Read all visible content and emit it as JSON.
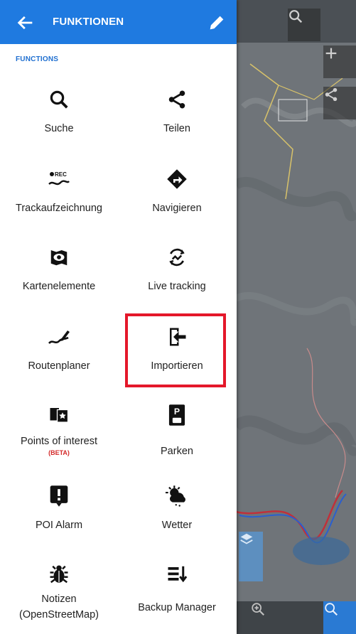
{
  "app_bar": {
    "title": "FUNKTIONEN",
    "back_icon": "arrow-left-icon",
    "edit_icon": "pencil-icon"
  },
  "section_title": "FUNCTIONS",
  "colors": {
    "app_bar": "#1f7ae0",
    "highlight_border": "#e4172a",
    "beta_badge": "#d42a2a"
  },
  "functions": [
    {
      "label": "Suche",
      "icon": "search-icon"
    },
    {
      "label": "Teilen",
      "icon": "share-icon"
    },
    {
      "label": "Trackaufzeichnung",
      "icon": "track-record-icon"
    },
    {
      "label": "Navigieren",
      "icon": "navigation-icon"
    },
    {
      "label": "Kartenelemente",
      "icon": "map-elements-icon"
    },
    {
      "label": "Live tracking",
      "icon": "live-tracking-icon"
    },
    {
      "label": "Routenplaner",
      "icon": "route-planner-icon"
    },
    {
      "label": "Importieren",
      "icon": "import-icon"
    },
    {
      "label": "Points of interest",
      "sub": "(BETA)",
      "icon": "poi-icon"
    },
    {
      "label": "Parken",
      "icon": "parking-icon"
    },
    {
      "label": "POI Alarm",
      "icon": "alarm-icon"
    },
    {
      "label": "Wetter",
      "icon": "weather-icon"
    },
    {
      "label": "Notizen",
      "label2": "(OpenStreetMap)",
      "icon": "bug-icon"
    },
    {
      "label": "Backup Manager",
      "icon": "backup-icon"
    }
  ],
  "map_controls": [
    "search-icon",
    "plus-icon",
    "share-icon",
    "layers-icon",
    "zoom-in-icon",
    "locate-icon"
  ]
}
